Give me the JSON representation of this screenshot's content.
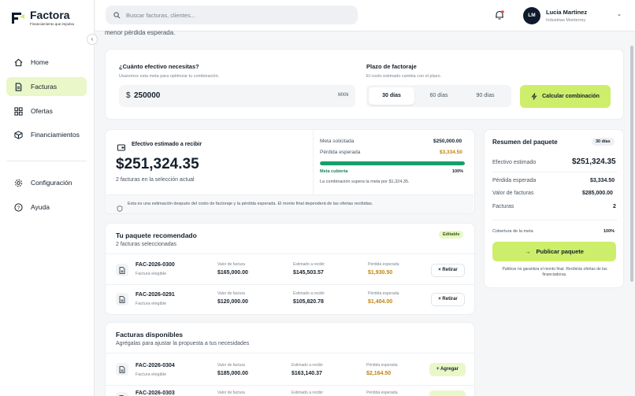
{
  "brand": {
    "name": "Factora",
    "tagline": "Financiamiento que impulsa",
    "accent": "#cdee6a"
  },
  "sidebar": {
    "collapse_icon": "chevron-left-icon",
    "items": [
      {
        "label": "Home",
        "icon": "home-icon"
      },
      {
        "label": "Facturas",
        "icon": "document-icon",
        "active": true
      },
      {
        "label": "Ofertas",
        "icon": "grid-icon"
      },
      {
        "label": "Financiamientos",
        "icon": "box-icon"
      },
      {
        "label": "Configuración",
        "icon": "gear-icon"
      },
      {
        "label": "Ayuda",
        "icon": "help-icon"
      }
    ]
  },
  "topbar": {
    "search_placeholder": "Buscar facturas, clientes...",
    "user": {
      "initials": "LM",
      "name": "Lucia Martinez",
      "company": "Industrias Monterrey"
    }
  },
  "page": {
    "intro_tail": "menor pérdida esperada."
  },
  "goal": {
    "question": "¿Cuánto efectivo necesitas?",
    "help": "Usaremos esta meta para optimizar tu combinación.",
    "currency_symbol": "$",
    "amount": "250000",
    "currency": "MXN",
    "term_title": "Plazo de factoraje",
    "term_help": "El costo estimado cambia con el plazo.",
    "terms": [
      "30 días",
      "60 días",
      "90 días"
    ],
    "selected_term": "30 días",
    "calculate_label": "Calcular combinación"
  },
  "estimate": {
    "title": "Efectivo estimado a recibir",
    "amount": "$251,324.35",
    "subtitle": "2 facturas en la selección actual",
    "meta_label": "Meta solicitada",
    "meta_value": "$250,000.00",
    "loss_label": "Pérdida esperada",
    "loss_value": "$3,334.50",
    "coverage_label": "Meta cubierta",
    "coverage_value": "100%",
    "coverage_fraction": 1.0,
    "note": "La combinación supera la meta por $1,324.35.",
    "footer": "Esta es una estimación después del costo de factoraje y la pérdida esperada. El monto final dependerá de las ofertas recibidas."
  },
  "package": {
    "title": "Tu paquete recomendado",
    "subtitle": "2 facturas seleccionadas",
    "badge": "Editable",
    "rows": [
      {
        "id": "FAC-2026-0300",
        "status": "Factura elegible",
        "value_label": "Valor de factura",
        "value": "$165,000.00",
        "receive_label": "Estimado a recibir",
        "receive": "$145,503.57",
        "loss_label": "Pérdida esperada",
        "loss": "$1,930.50",
        "action": "Retirar"
      },
      {
        "id": "FAC-2026-0291",
        "status": "Factura elegible",
        "value_label": "Valor de factura",
        "value": "$120,000.00",
        "receive_label": "Estimado a recibir",
        "receive": "$105,820.78",
        "loss_label": "Pérdida esperada",
        "loss": "$1,404.00",
        "action": "Retirar"
      }
    ]
  },
  "available": {
    "title": "Facturas disponibles",
    "subtitle": "Agrégalas para ajustar la propuesta a tus necesidades",
    "rows": [
      {
        "id": "FAC-2026-0304",
        "status": "Factura elegible",
        "value_label": "Valor de factura",
        "value": "$185,000.00",
        "receive_label": "Estimado a recibir",
        "receive": "$163,140.37",
        "loss_label": "Pérdida esperada",
        "loss": "$2,164.50",
        "action": "Agregar"
      },
      {
        "id": "FAC-2026-0303",
        "value_label": "Valor de factura",
        "receive_label": "Estimado a recibir",
        "loss_label": "Pérdida esperada"
      }
    ]
  },
  "summary": {
    "title": "Resumen del paquete",
    "term_badge": "30 días",
    "lines": [
      {
        "label": "Efectivo estimado",
        "value": "$251,324.35"
      },
      {
        "label": "Pérdida esperada",
        "value": "$3,334.50"
      },
      {
        "label": "Valor de facturas",
        "value": "$285,000.00"
      },
      {
        "label": "Facturas",
        "value": "2"
      }
    ],
    "coverage_label": "Cobertura de la meta",
    "coverage_value": "100%",
    "publish_label": "Publicar paquete",
    "disclaimer": "Publicar no garantiza el monto final. Recibirás ofertas de las financiadoras."
  }
}
